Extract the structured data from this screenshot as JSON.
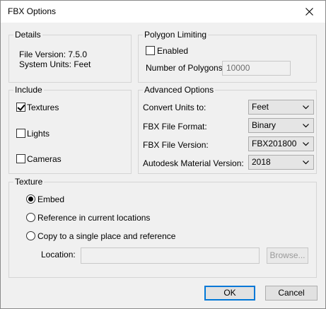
{
  "window": {
    "title": "FBX Options"
  },
  "details": {
    "legend": "Details",
    "file_version": "File Version: 7.5.0",
    "system_units": "System Units: Feet"
  },
  "polygon_limiting": {
    "legend": "Polygon Limiting",
    "enabled_label": "Enabled",
    "enabled_checked": false,
    "num_polygons_label": "Number of Polygons:",
    "num_polygons_value": "10000"
  },
  "include": {
    "legend": "Include",
    "textures": {
      "label": "Textures",
      "checked": true
    },
    "lights": {
      "label": "Lights",
      "checked": false
    },
    "cameras": {
      "label": "Cameras",
      "checked": false
    }
  },
  "advanced": {
    "legend": "Advanced Options",
    "convert_units": {
      "label": "Convert Units to:",
      "value": "Feet"
    },
    "fbx_format": {
      "label": "FBX File Format:",
      "value": "Binary"
    },
    "fbx_version": {
      "label": "FBX File Version:",
      "value": "FBX201800"
    },
    "material_version": {
      "label": "Autodesk Material Version:",
      "value": "2018"
    }
  },
  "texture": {
    "legend": "Texture",
    "embed_label": "Embed",
    "reference_label": "Reference in current locations",
    "copy_label": "Copy to a single place and reference",
    "selected": "embed",
    "location_label": "Location:",
    "location_value": "",
    "browse_label": "Browse..."
  },
  "buttons": {
    "ok": "OK",
    "cancel": "Cancel"
  },
  "icons": {
    "close": "close-icon",
    "dropdown": "chevron-down-icon"
  },
  "colors": {
    "window_bg": "#f0f0f0",
    "focus_border": "#0078d7"
  }
}
